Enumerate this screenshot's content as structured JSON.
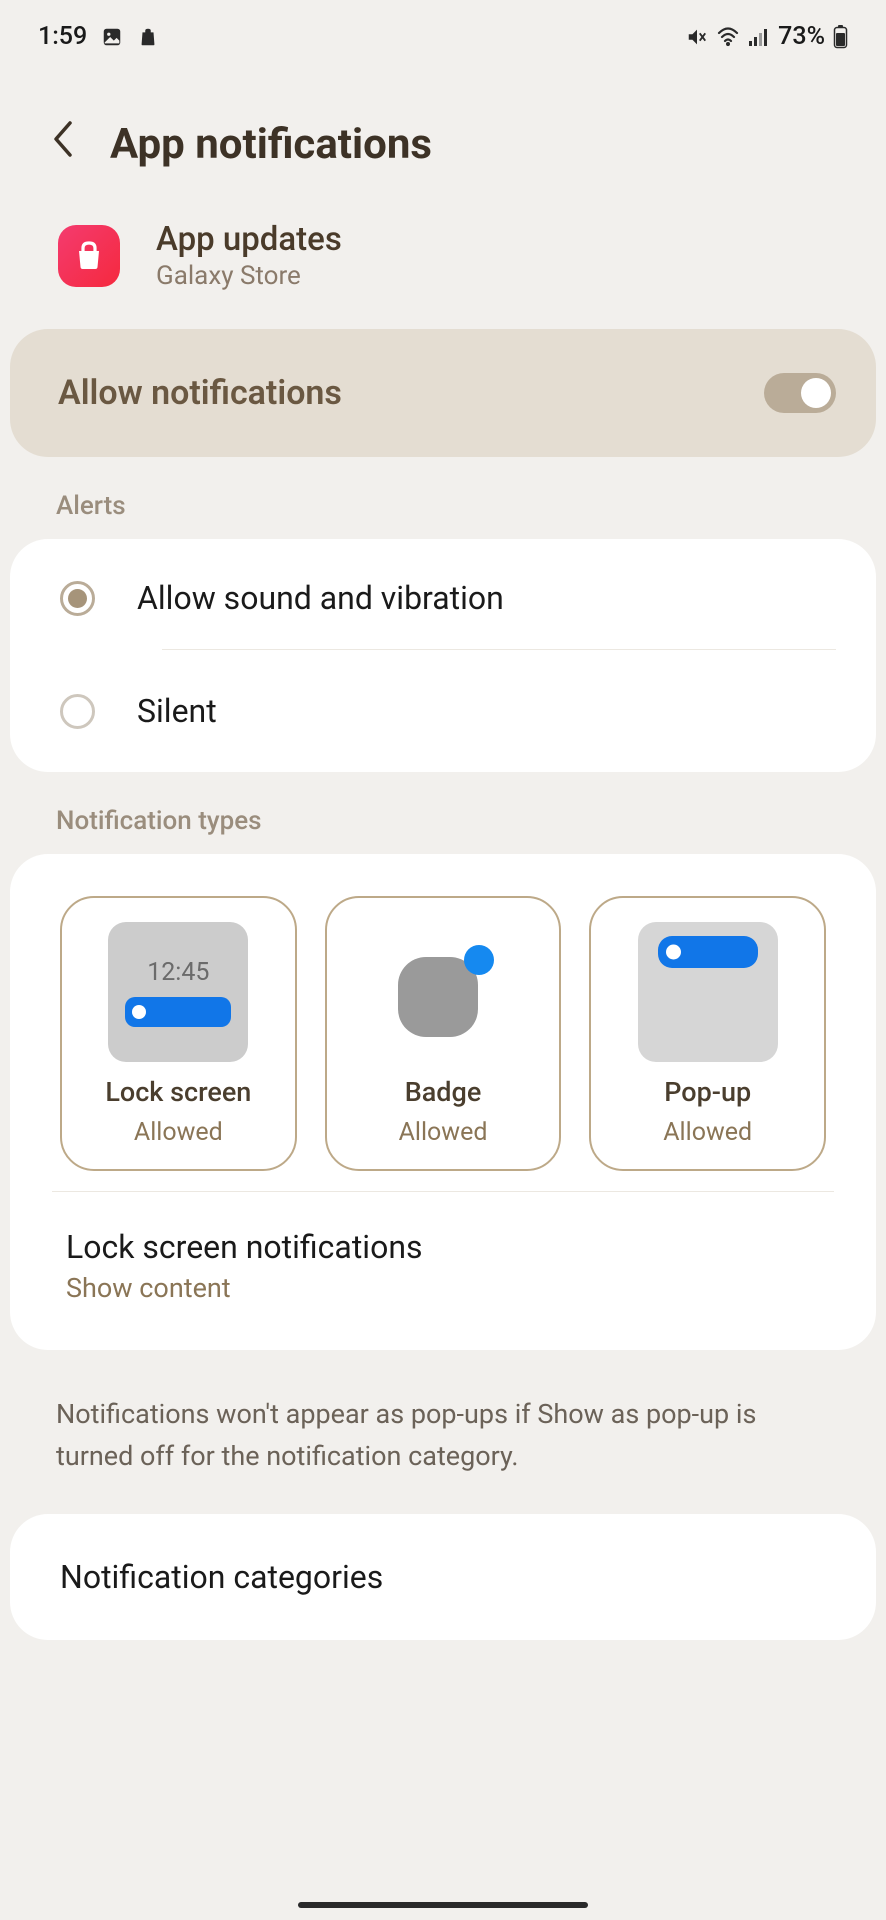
{
  "status_bar": {
    "time": "1:59",
    "battery_text": "73%"
  },
  "header": {
    "title": "App notifications"
  },
  "app": {
    "name": "App updates",
    "subtitle": "Galaxy Store"
  },
  "allow": {
    "label": "Allow notifications",
    "enabled": true
  },
  "sections": {
    "alerts_label": "Alerts",
    "types_label": "Notification types"
  },
  "alerts": {
    "option_sound": "Allow sound and vibration",
    "option_silent": "Silent"
  },
  "types": {
    "lock_screen": {
      "preview_time": "12:45",
      "name": "Lock screen",
      "status": "Allowed"
    },
    "badge": {
      "name": "Badge",
      "status": "Allowed"
    },
    "popup": {
      "name": "Pop-up",
      "status": "Allowed"
    }
  },
  "lock_screen_notifications": {
    "title": "Lock screen notifications",
    "subtitle": "Show content"
  },
  "info_text": "Notifications won't appear as pop-ups if Show as pop-up is turned off for the notification category.",
  "categories": {
    "title": "Notification categories"
  }
}
